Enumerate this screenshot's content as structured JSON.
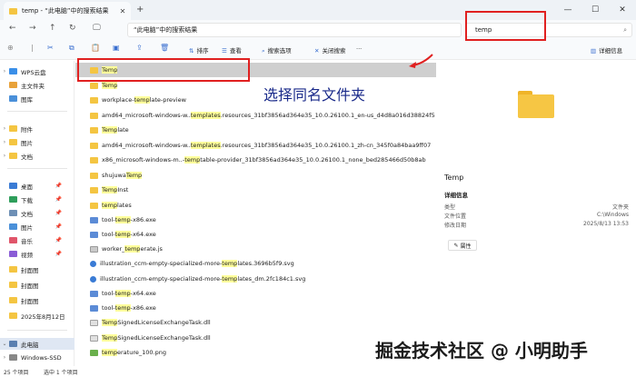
{
  "window": {
    "tab_title": "temp - “此电脑”中的搜索结果",
    "new_tab": "+",
    "min": "—",
    "max": "☐",
    "close": "✕"
  },
  "addressbar": {
    "path": "“此电脑”中的搜索结果",
    "search_value": "temp"
  },
  "toolbar": {
    "sort": "排序",
    "view": "查看",
    "search_options": "搜索选项",
    "close_search": "关闭搜索",
    "details": "详细信息"
  },
  "sidebar": {
    "items": [
      {
        "label": "WPS云盘",
        "arrow": "›"
      },
      {
        "label": "主文件夹",
        "arrow": ""
      },
      {
        "label": "图库",
        "arrow": ""
      },
      {
        "label": "附件",
        "arrow": "›"
      },
      {
        "label": "图片",
        "arrow": "›"
      },
      {
        "label": "文档",
        "arrow": "›"
      },
      {
        "label": "桌面",
        "arrow": ""
      },
      {
        "label": "下载",
        "arrow": ""
      },
      {
        "label": "文档",
        "arrow": ""
      },
      {
        "label": "图片",
        "arrow": ""
      },
      {
        "label": "音乐",
        "arrow": ""
      },
      {
        "label": "视频",
        "arrow": ""
      },
      {
        "label": "封面图",
        "arrow": ""
      },
      {
        "label": "封面图",
        "arrow": ""
      },
      {
        "label": "封面图",
        "arrow": ""
      },
      {
        "label": "2025年8月12日",
        "arrow": ""
      },
      {
        "label": "此电脑",
        "arrow": "⌄"
      },
      {
        "label": "Windows-SSD",
        "arrow": "›"
      }
    ]
  },
  "files": [
    {
      "pre": "",
      "hl": "Temp",
      "post": ""
    },
    {
      "pre": "",
      "hl": "Temp",
      "post": ""
    },
    {
      "pre": "workplace-",
      "hl": "temp",
      "post": "late-preview"
    },
    {
      "pre": "amd64_microsoft-windows-w..",
      "hl": "templates",
      "post": ".resources_31bf3856ad364e35_10.0.26100.1_en-us_d4d8a016d38824f5"
    },
    {
      "pre": "",
      "hl": "Temp",
      "post": "late"
    },
    {
      "pre": "amd64_microsoft-windows-w..",
      "hl": "templates",
      "post": ".resources_31bf3856ad364e35_10.0.26100.1_zh-cn_345f0a84baa9ff07"
    },
    {
      "pre": "x86_microsoft-windows-m..-",
      "hl": "temp",
      "post": "table-provider_31bf3856ad364e35_10.0.26100.1_none_bed285466d50b8ab"
    },
    {
      "pre": "shujuwa ",
      "hl": "Temp",
      "post": ""
    },
    {
      "pre": "",
      "hl": "Temp",
      "post": "Inst"
    },
    {
      "pre": "",
      "hl": "temp",
      "post": "lates"
    },
    {
      "pre": "tool-",
      "hl": "temp",
      "post": "-x86.exe"
    },
    {
      "pre": "tool-",
      "hl": "temp",
      "post": "-x64.exe"
    },
    {
      "pre": "worker_",
      "hl": "temp",
      "post": "erate.js"
    },
    {
      "pre": "illustration_ccm-empty-specialized-more-",
      "hl": "temp",
      "post": "lates.3696b5f9.svg"
    },
    {
      "pre": "illustration_ccm-empty-specialized-more-",
      "hl": "temp",
      "post": "lates_dm.2fc184c1.svg"
    },
    {
      "pre": "tool-",
      "hl": "temp",
      "post": "-x64.exe"
    },
    {
      "pre": "tool-",
      "hl": "temp",
      "post": "-x86.exe"
    },
    {
      "pre": "",
      "hl": "Temp",
      "post": "SignedLicenseExchangeTask.dll"
    },
    {
      "pre": "",
      "hl": "Temp",
      "post": "SignedLicenseExchangeTask.dll"
    },
    {
      "pre": "",
      "hl": "temp",
      "post": "erature_100.png"
    }
  ],
  "details": {
    "name": "Temp",
    "heading": "详细信息",
    "rows": [
      {
        "k": "类型",
        "v": "文件夹"
      },
      {
        "k": "文件位置",
        "v": "C:\\Windows"
      },
      {
        "k": "修改日期",
        "v": "2025/8/13 13:53"
      }
    ],
    "properties": "属性"
  },
  "status": {
    "count": "25 个项目",
    "selected": "选中 1 个项目"
  },
  "annotation": "选择同名文件夹",
  "watermark": "掘金技术社区 @ 小明助手"
}
